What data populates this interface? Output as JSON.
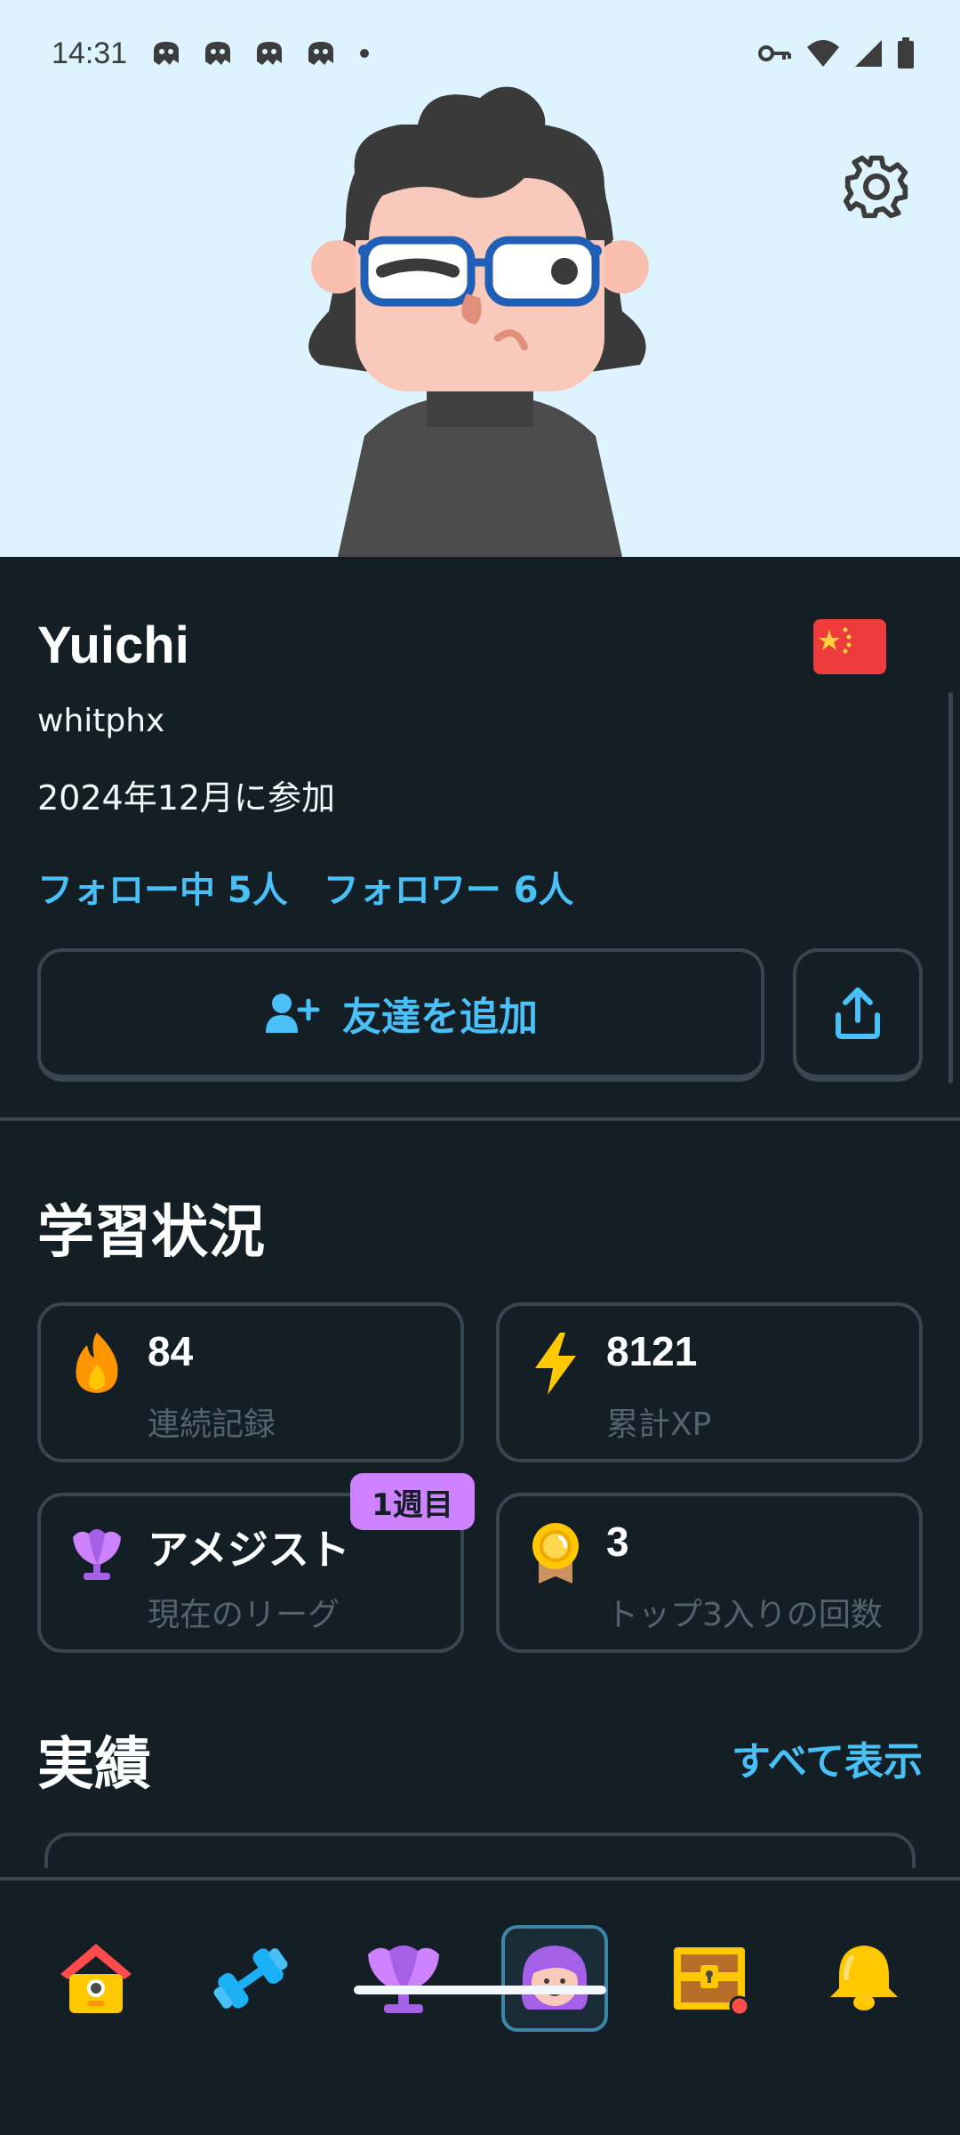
{
  "status_bar": {
    "time": "14:31"
  },
  "profile": {
    "name": "Yuichi",
    "username": "whitphx",
    "joined": "2024年12月に参加",
    "following": "フォロー中 5人",
    "followers": "フォロワー 6人",
    "add_friend_label": "友達を追加"
  },
  "stats": {
    "title": "学習状況",
    "cards": [
      {
        "value": "84",
        "label": "連続記録",
        "icon": "flame-icon"
      },
      {
        "value": "8121",
        "label": "累計XP",
        "icon": "lightning-icon"
      },
      {
        "value": "アメジスト",
        "label": "現在のリーグ",
        "icon": "amethyst-trophy-icon",
        "badge": "1週目"
      },
      {
        "value": "3",
        "label": "トップ3入りの回数",
        "icon": "medal-icon"
      }
    ]
  },
  "achievements": {
    "title": "実績",
    "see_all": "すべて表示"
  },
  "nav": {
    "items": [
      "home-icon",
      "practice-dumbbell-icon",
      "league-trophy-icon",
      "profile-avatar-icon",
      "treasure-chest-icon",
      "notification-bell-icon"
    ],
    "active": "profile-avatar-icon"
  },
  "colors": {
    "background": "#131f24",
    "header": "#ddf4ff",
    "accent": "#49c0f8",
    "border": "#37464f",
    "badge": "#ce82ff"
  }
}
